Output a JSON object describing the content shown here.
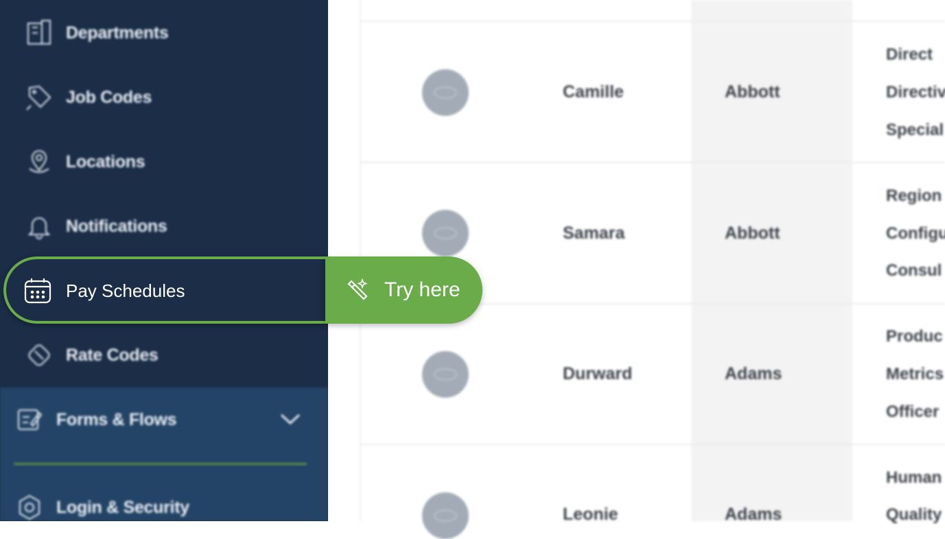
{
  "sidebar": {
    "items": [
      {
        "label": "Departments",
        "icon": "building-icon"
      },
      {
        "label": "Job Codes",
        "icon": "tag-icon"
      },
      {
        "label": "Locations",
        "icon": "map-pin-icon"
      },
      {
        "label": "Notifications",
        "icon": "bell-icon"
      },
      {
        "label": "Pay Schedules",
        "icon": "calendar-icon"
      },
      {
        "label": "Rate Codes",
        "icon": "rate-tag-icon"
      }
    ],
    "forms": {
      "label": "Forms & Flows",
      "icon": "form-edit-icon"
    },
    "login": {
      "label": "Login & Security",
      "icon": "gear-icon"
    }
  },
  "highlight": {
    "try_label": "Try here",
    "try_icon": "magic-wand-icon",
    "accent": "#6aac4a"
  },
  "table": {
    "rows": [
      {
        "first": "Camille",
        "last": "Abbott",
        "roles": [
          "Direct",
          "Directiv",
          "Special"
        ]
      },
      {
        "first": "Samara",
        "last": "Abbott",
        "roles": [
          "Region",
          "Configu",
          "Consul"
        ]
      },
      {
        "first": "Durward",
        "last": "Adams",
        "roles": [
          "Produc",
          "Metrics",
          "Officer"
        ]
      },
      {
        "first": "Leonie",
        "last": "Adams",
        "roles": [
          "Human",
          "Quality"
        ]
      }
    ]
  },
  "colors": {
    "sidebar": "#1b2d47",
    "forms_section": "#234466"
  }
}
